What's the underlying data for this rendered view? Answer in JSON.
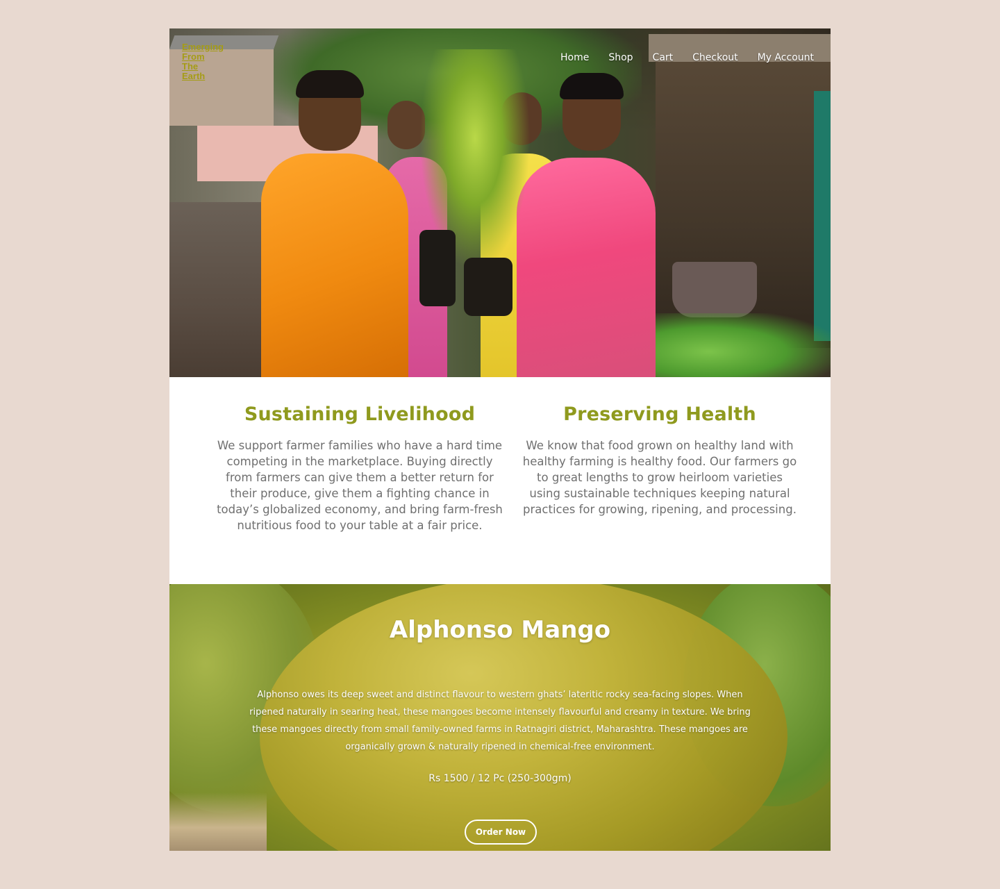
{
  "brand": {
    "logo_lines": [
      "Emerging",
      "From",
      "The",
      "Earth"
    ]
  },
  "nav": {
    "items": [
      "Home",
      "Shop",
      "Cart",
      "Checkout",
      "My Account"
    ]
  },
  "intro": {
    "left": {
      "title": "Sustaining Livelihood",
      "text": "We support farmer families who have a hard time competing in the marketplace. Buying directly from farmers can give them a better return for their produce, give them a fighting chance in today’s globalized economy, and bring farm-fresh nutritious food to your table at a fair price."
    },
    "right": {
      "title": "Preserving Health",
      "text": "We know that food grown on healthy land with healthy farming is healthy food. Our farmers go to great lengths to grow heirloom varieties using sustainable techniques keeping natural practices for growing, ripening, and processing."
    }
  },
  "product": {
    "title": "Alphonso Mango",
    "description": "Alphonso owes its deep sweet and distinct flavour to western ghats’ lateritic rocky sea-facing slopes. When ripened naturally in searing heat, these mangoes become intensely flavourful and creamy in texture. We bring these mangoes directly from small family-owned farms in Ratnagiri district, Maharashtra. These mangoes are organically grown & naturally ripened in chemical-free environment.",
    "price": "Rs 1500 / 12 Pc (250-300gm)",
    "cta": "Order Now"
  },
  "colors": {
    "page_background": "#e8d9d0",
    "accent_green": "#8f9a1e",
    "logo_olive": "#a59c16",
    "body_text": "#6f6f6f"
  }
}
